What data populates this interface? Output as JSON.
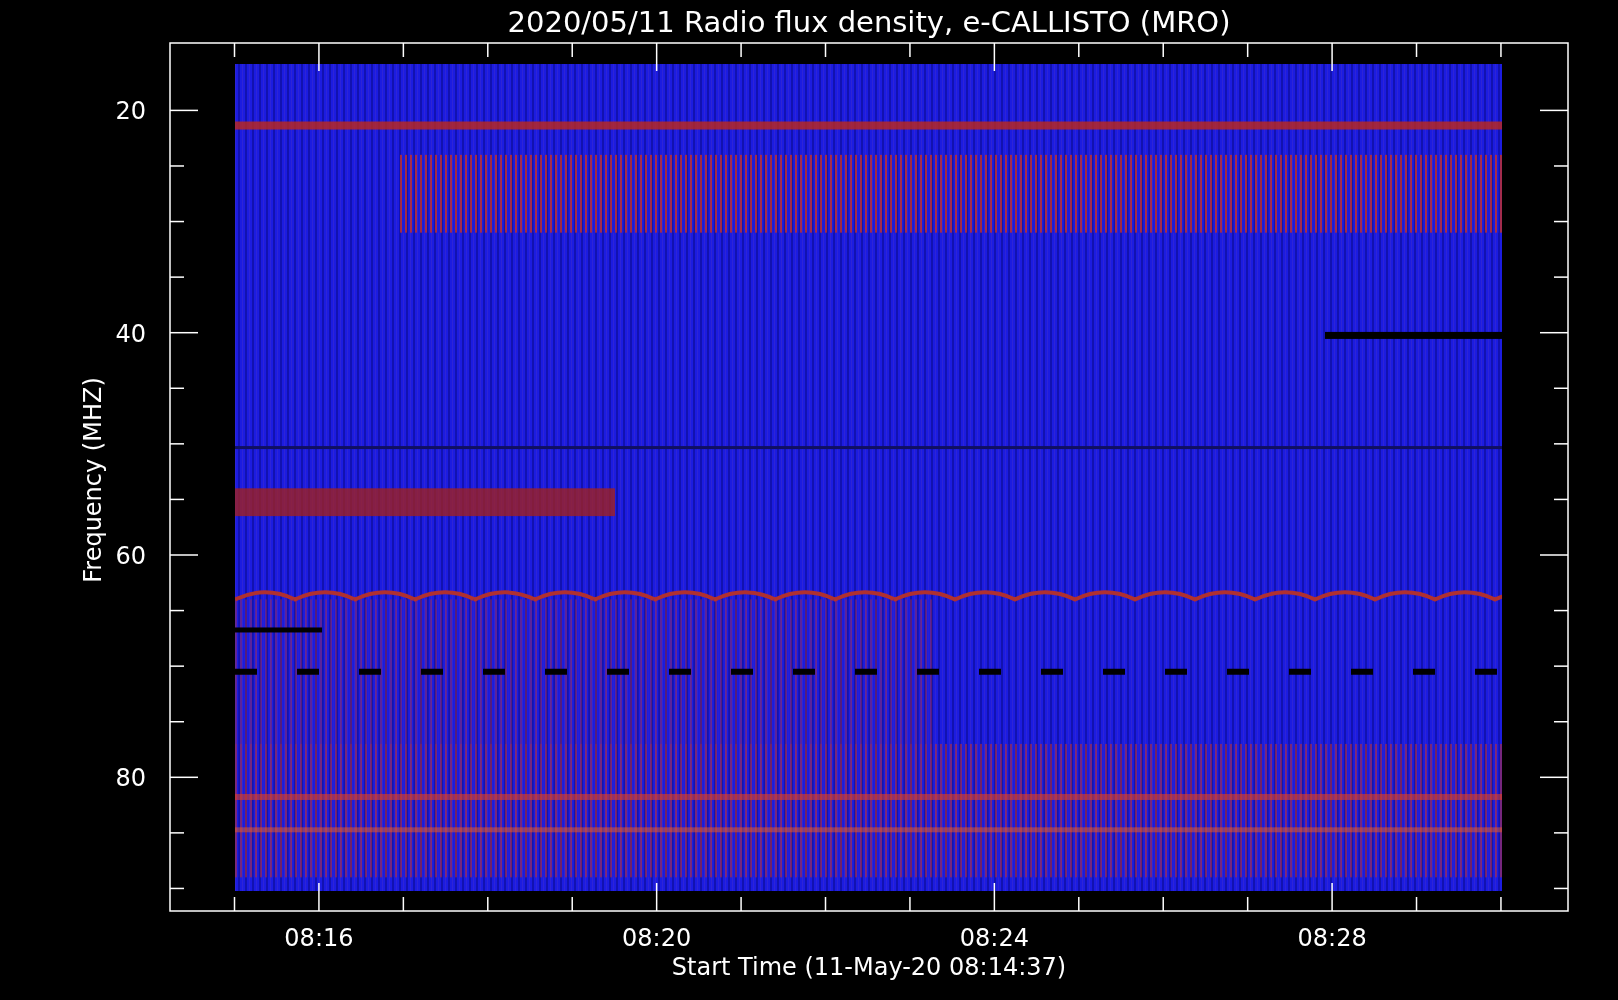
{
  "title": "2020/05/11  Radio flux density, e-CALLISTO (MRO)",
  "y_axis": {
    "label": "Frequency (MHZ)",
    "ticks": [
      "20",
      "40",
      "60",
      "80"
    ]
  },
  "x_axis": {
    "label": "Start Time (11-May-20 08:14:37)",
    "ticks": [
      "08:16",
      "08:20",
      "08:24",
      "08:28"
    ]
  }
}
